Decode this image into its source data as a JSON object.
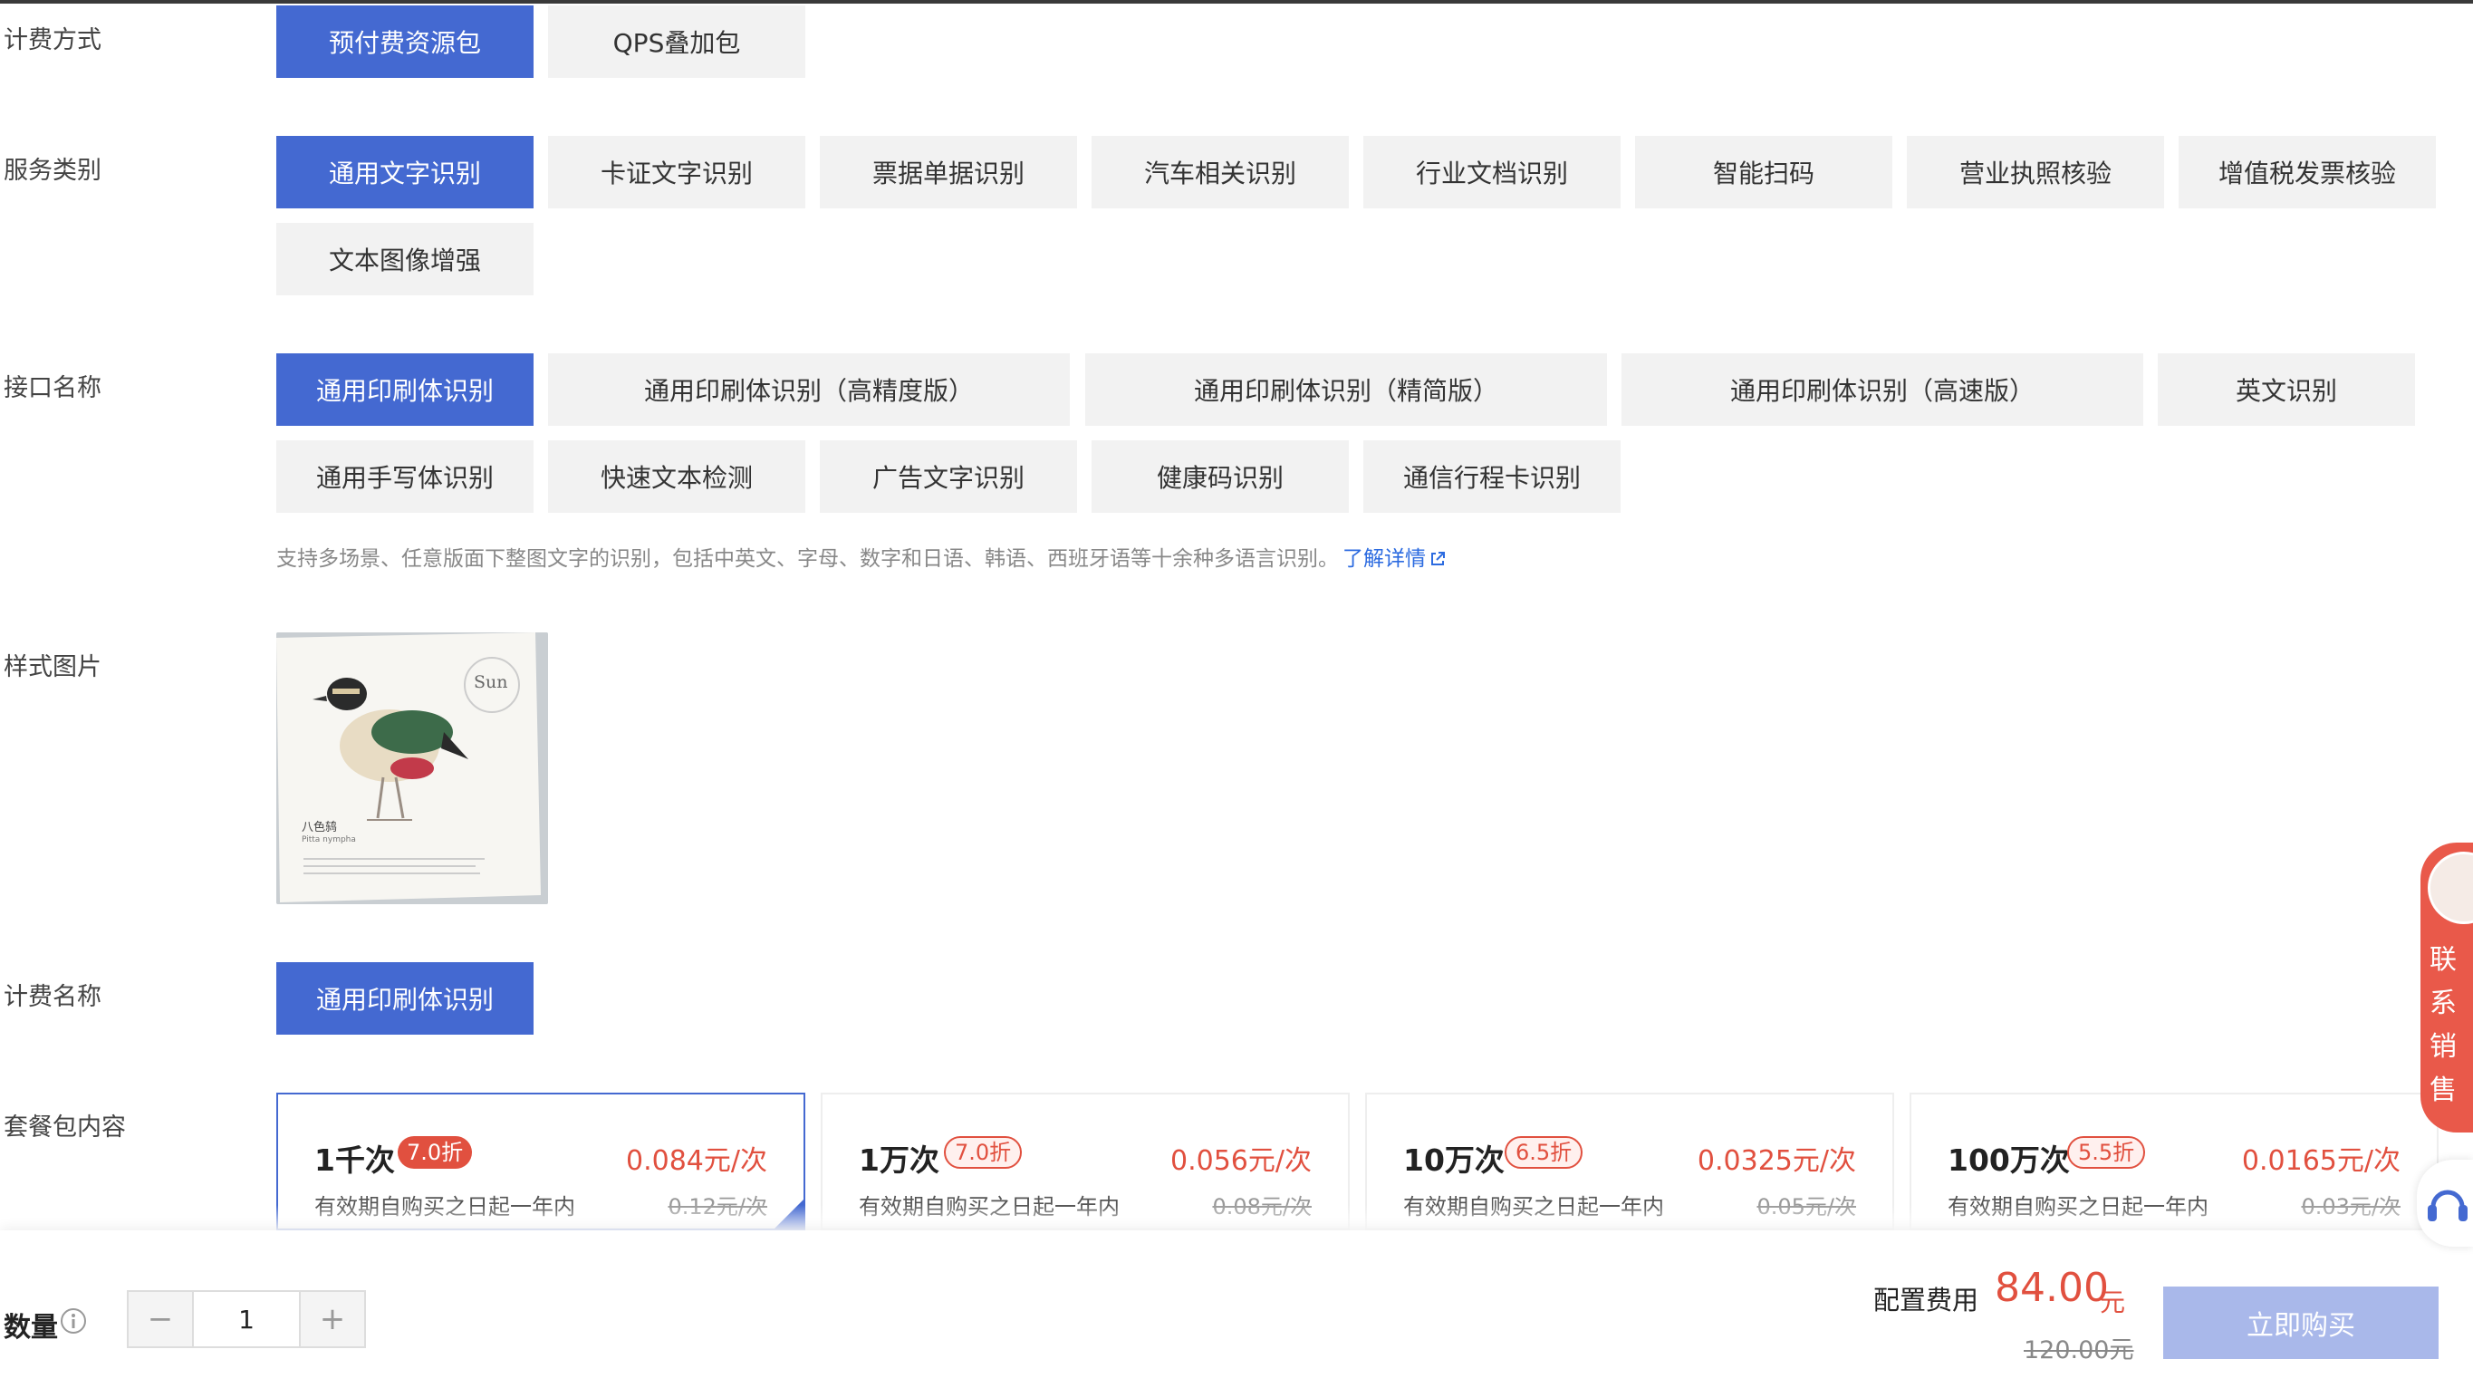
{
  "labels": {
    "billing_mode": "计费方式",
    "service_category": "服务类别",
    "api_name": "接口名称",
    "sample_image": "样式图片",
    "billing_name": "计费名称",
    "package_content": "套餐包内容",
    "quantity": "数量"
  },
  "billing_modes": [
    "预付费资源包",
    "QPS叠加包"
  ],
  "service_categories": [
    "通用文字识别",
    "卡证文字识别",
    "票据单据识别",
    "汽车相关识别",
    "行业文档识别",
    "智能扫码",
    "营业执照核验",
    "增值税发票核验",
    "文本图像增强"
  ],
  "api_names": [
    "通用印刷体识别",
    "通用印刷体识别（高精度版）",
    "通用印刷体识别（精简版）",
    "通用印刷体识别（高速版）",
    "英文识别",
    "通用手写体识别",
    "快速文本检测",
    "广告文字识别",
    "健康码识别",
    "通信行程卡识别"
  ],
  "description": {
    "text": "支持多场景、任意版面下整图文字的识别，包括中英文、字母、数字和日语、韩语、西班牙语等十余种多语言识别。",
    "link": "了解详情"
  },
  "sample": {
    "title": "Sun",
    "bird_name": "八色鸫",
    "latin": "Pitta nympha"
  },
  "billing_name_value": "通用印刷体识别",
  "packages": [
    {
      "name": "1千次",
      "discount": "7.0折",
      "price": "0.084元/次",
      "validity": "有效期自购买之日起一年内",
      "original": "0.12元/次"
    },
    {
      "name": "1万次",
      "discount": "7.0折",
      "price": "0.056元/次",
      "validity": "有效期自购买之日起一年内",
      "original": "0.08元/次"
    },
    {
      "name": "10万次",
      "discount": "6.5折",
      "price": "0.0325元/次",
      "validity": "有效期自购买之日起一年内",
      "original": "0.05元/次"
    },
    {
      "name": "100万次",
      "discount": "5.5折",
      "price": "0.0165元/次",
      "validity": "有效期自购买之日起一年内",
      "original": "0.03元/次"
    }
  ],
  "stepper": {
    "minus": "−",
    "value": "1",
    "plus": "+"
  },
  "fee": {
    "label": "配置费用",
    "amount": "84.00",
    "unit": "元",
    "original": "120.00元"
  },
  "buy_button": "立即购买",
  "contact": "联系销售",
  "colors": {
    "primary": "#4469d1",
    "price_red": "#e1503f",
    "disabled_button": "#a9b8ea"
  }
}
